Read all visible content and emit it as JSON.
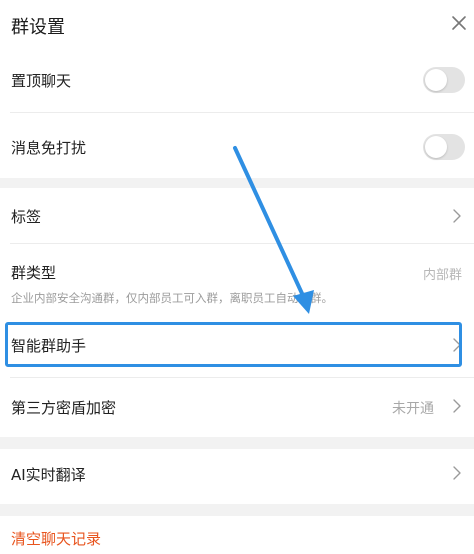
{
  "header": {
    "title": "群设置"
  },
  "rows": {
    "pin_chat": {
      "label": "置顶聊天",
      "toggle_on": false
    },
    "mute": {
      "label": "消息免打扰",
      "toggle_on": false
    },
    "tags": {
      "label": "标签"
    },
    "group_type": {
      "label": "群类型",
      "value": "内部群",
      "description": "企业内部安全沟通群，仅内部员工可入群，离职员工自动退群。"
    },
    "smart_assistant": {
      "label": "智能群助手"
    },
    "encryption": {
      "label": "第三方密盾加密",
      "value": "未开通"
    },
    "ai_translate": {
      "label": "AI实时翻译"
    },
    "clear_history": {
      "label": "清空聊天记录"
    }
  },
  "colors": {
    "highlight": "#2f8fe3",
    "danger": "#e8541e",
    "section_gap": "#f2f2f2"
  },
  "icons": {
    "close": "close-icon",
    "chevron": "chevron-right-icon"
  }
}
